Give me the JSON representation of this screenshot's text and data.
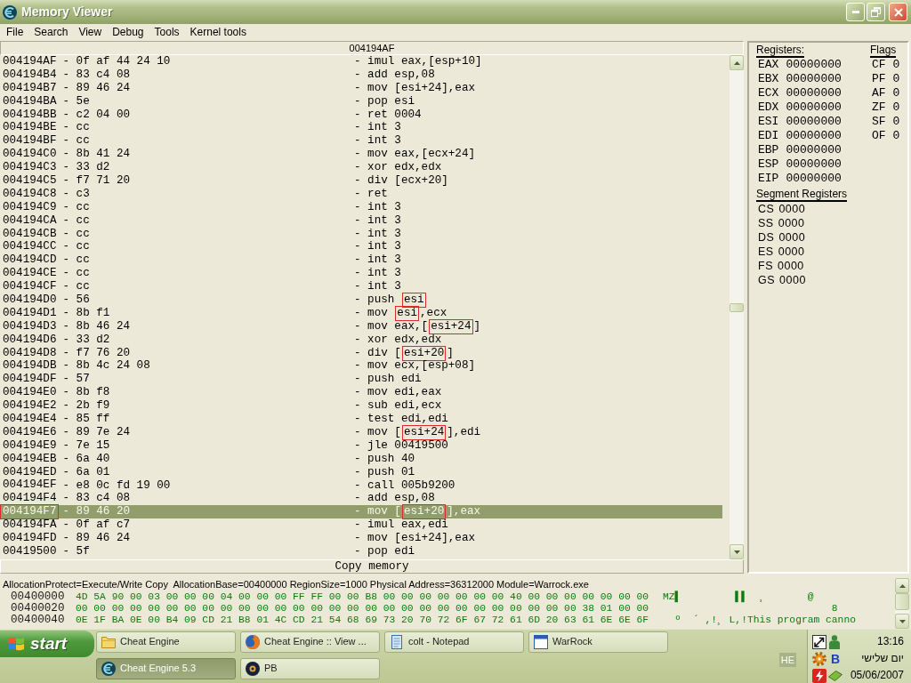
{
  "window": {
    "title": "Memory Viewer"
  },
  "menu": [
    "File",
    "Search",
    "View",
    "Debug",
    "Tools",
    "Kernel tools"
  ],
  "disassembly": {
    "header": "004194AF",
    "rows": [
      {
        "address": "004194AF",
        "bytes": "- 0f af 44 24 10",
        "instruction": [
          {
            "text": "- imul eax,[esp+10]",
            "boxed": false
          }
        ],
        "selected": false,
        "address_boxed": false
      },
      {
        "address": "004194B4",
        "bytes": "- 83 c4 08",
        "instruction": [
          {
            "text": "- add esp,08",
            "boxed": false
          }
        ],
        "selected": false,
        "address_boxed": false
      },
      {
        "address": "004194B7",
        "bytes": "- 89 46 24",
        "instruction": [
          {
            "text": "- mov [esi+24],eax",
            "boxed": false
          }
        ],
        "selected": false,
        "address_boxed": false
      },
      {
        "address": "004194BA",
        "bytes": "- 5e",
        "instruction": [
          {
            "text": "- pop esi",
            "boxed": false
          }
        ],
        "selected": false,
        "address_boxed": false
      },
      {
        "address": "004194BB",
        "bytes": "- c2 04 00",
        "instruction": [
          {
            "text": "- ret 0004",
            "boxed": false
          }
        ],
        "selected": false,
        "address_boxed": false
      },
      {
        "address": "004194BE",
        "bytes": "- cc",
        "instruction": [
          {
            "text": "- int 3",
            "boxed": false
          }
        ],
        "selected": false,
        "address_boxed": false
      },
      {
        "address": "004194BF",
        "bytes": "- cc",
        "instruction": [
          {
            "text": "- int 3",
            "boxed": false
          }
        ],
        "selected": false,
        "address_boxed": false
      },
      {
        "address": "004194C0",
        "bytes": "- 8b 41 24",
        "instruction": [
          {
            "text": "- mov eax,[ecx+24]",
            "boxed": false
          }
        ],
        "selected": false,
        "address_boxed": false
      },
      {
        "address": "004194C3",
        "bytes": "- 33 d2",
        "instruction": [
          {
            "text": "- xor edx,edx",
            "boxed": false
          }
        ],
        "selected": false,
        "address_boxed": false
      },
      {
        "address": "004194C5",
        "bytes": "- f7 71 20",
        "instruction": [
          {
            "text": "- div [ecx+20]",
            "boxed": false
          }
        ],
        "selected": false,
        "address_boxed": false
      },
      {
        "address": "004194C8",
        "bytes": "- c3",
        "instruction": [
          {
            "text": "- ret",
            "boxed": false
          }
        ],
        "selected": false,
        "address_boxed": false
      },
      {
        "address": "004194C9",
        "bytes": "- cc",
        "instruction": [
          {
            "text": "- int 3",
            "boxed": false
          }
        ],
        "selected": false,
        "address_boxed": false
      },
      {
        "address": "004194CA",
        "bytes": "- cc",
        "instruction": [
          {
            "text": "- int 3",
            "boxed": false
          }
        ],
        "selected": false,
        "address_boxed": false
      },
      {
        "address": "004194CB",
        "bytes": "- cc",
        "instruction": [
          {
            "text": "- int 3",
            "boxed": false
          }
        ],
        "selected": false,
        "address_boxed": false
      },
      {
        "address": "004194CC",
        "bytes": "- cc",
        "instruction": [
          {
            "text": "- int 3",
            "boxed": false
          }
        ],
        "selected": false,
        "address_boxed": false
      },
      {
        "address": "004194CD",
        "bytes": "- cc",
        "instruction": [
          {
            "text": "- int 3",
            "boxed": false
          }
        ],
        "selected": false,
        "address_boxed": false
      },
      {
        "address": "004194CE",
        "bytes": "- cc",
        "instruction": [
          {
            "text": "- int 3",
            "boxed": false
          }
        ],
        "selected": false,
        "address_boxed": false
      },
      {
        "address": "004194CF",
        "bytes": "- cc",
        "instruction": [
          {
            "text": "- int 3",
            "boxed": false
          }
        ],
        "selected": false,
        "address_boxed": false
      },
      {
        "address": "004194D0",
        "bytes": "- 56",
        "instruction": [
          {
            "text": "- push ",
            "boxed": false
          },
          {
            "text": "esi",
            "boxed": true
          }
        ],
        "selected": false,
        "address_boxed": false
      },
      {
        "address": "004194D1",
        "bytes": "- 8b f1",
        "instruction": [
          {
            "text": "- mov ",
            "boxed": false
          },
          {
            "text": "esi",
            "boxed": true
          },
          {
            "text": ",ecx",
            "boxed": false
          }
        ],
        "selected": false,
        "address_boxed": false
      },
      {
        "address": "004194D3",
        "bytes": "- 8b 46 24",
        "instruction": [
          {
            "text": "- mov eax,[",
            "boxed": false
          },
          {
            "text": "esi+24",
            "boxed": true
          },
          {
            "text": "]",
            "boxed": false
          }
        ],
        "selected": false,
        "address_boxed": false
      },
      {
        "address": "004194D6",
        "bytes": "- 33 d2",
        "instruction": [
          {
            "text": "- xor edx,edx",
            "boxed": false
          }
        ],
        "selected": false,
        "address_boxed": false
      },
      {
        "address": "004194D8",
        "bytes": "- f7 76 20",
        "instruction": [
          {
            "text": "- div [",
            "boxed": false
          },
          {
            "text": "esi+20",
            "boxed": true
          },
          {
            "text": "]",
            "boxed": false
          }
        ],
        "selected": false,
        "address_boxed": false
      },
      {
        "address": "004194DB",
        "bytes": "- 8b 4c 24 08",
        "instruction": [
          {
            "text": "- mov ecx,[esp+08]",
            "boxed": false
          }
        ],
        "selected": false,
        "address_boxed": false
      },
      {
        "address": "004194DF",
        "bytes": "- 57",
        "instruction": [
          {
            "text": "- push edi",
            "boxed": false
          }
        ],
        "selected": false,
        "address_boxed": false
      },
      {
        "address": "004194E0",
        "bytes": "- 8b f8",
        "instruction": [
          {
            "text": "- mov edi,eax",
            "boxed": false
          }
        ],
        "selected": false,
        "address_boxed": false
      },
      {
        "address": "004194E2",
        "bytes": "- 2b f9",
        "instruction": [
          {
            "text": "- sub edi,ecx",
            "boxed": false
          }
        ],
        "selected": false,
        "address_boxed": false
      },
      {
        "address": "004194E4",
        "bytes": "- 85 ff",
        "instruction": [
          {
            "text": "- test edi,edi",
            "boxed": false
          }
        ],
        "selected": false,
        "address_boxed": false
      },
      {
        "address": "004194E6",
        "bytes": "- 89 7e 24",
        "instruction": [
          {
            "text": "- mov [",
            "boxed": false
          },
          {
            "text": "esi+24",
            "boxed": true
          },
          {
            "text": "],edi",
            "boxed": false
          }
        ],
        "selected": false,
        "address_boxed": false
      },
      {
        "address": "004194E9",
        "bytes": "- 7e 15",
        "instruction": [
          {
            "text": "- jle 00419500",
            "boxed": false
          }
        ],
        "selected": false,
        "address_boxed": false
      },
      {
        "address": "004194EB",
        "bytes": "- 6a 40",
        "instruction": [
          {
            "text": "- push 40",
            "boxed": false
          }
        ],
        "selected": false,
        "address_boxed": false
      },
      {
        "address": "004194ED",
        "bytes": "- 6a 01",
        "instruction": [
          {
            "text": "- push 01",
            "boxed": false
          }
        ],
        "selected": false,
        "address_boxed": false
      },
      {
        "address": "004194EF",
        "bytes": "- e8 0c fd 19 00",
        "instruction": [
          {
            "text": "- call 005b9200",
            "boxed": false
          }
        ],
        "selected": false,
        "address_boxed": false
      },
      {
        "address": "004194F4",
        "bytes": "- 83 c4 08",
        "instruction": [
          {
            "text": "- add esp,08",
            "boxed": false
          }
        ],
        "selected": false,
        "address_boxed": false
      },
      {
        "address": "004194F7",
        "bytes": "- 89 46 20",
        "instruction": [
          {
            "text": "- mov [",
            "boxed": false
          },
          {
            "text": "esi+20",
            "boxed": true
          },
          {
            "text": "],eax",
            "boxed": false
          }
        ],
        "selected": true,
        "address_boxed": true
      },
      {
        "address": "004194FA",
        "bytes": "- 0f af c7",
        "instruction": [
          {
            "text": "- imul eax,edi",
            "boxed": false
          }
        ],
        "selected": false,
        "address_boxed": false
      },
      {
        "address": "004194FD",
        "bytes": "- 89 46 24",
        "instruction": [
          {
            "text": "- mov [esi+24],eax",
            "boxed": false
          }
        ],
        "selected": false,
        "address_boxed": false
      },
      {
        "address": "00419500",
        "bytes": "- 5f",
        "instruction": [
          {
            "text": "- pop edi",
            "boxed": false
          }
        ],
        "selected": false,
        "address_boxed": false
      }
    ],
    "footer": "Copy memory"
  },
  "registers": {
    "title": "Registers:",
    "items": [
      {
        "name": "EAX",
        "value": "00000000"
      },
      {
        "name": "EBX",
        "value": "00000000"
      },
      {
        "name": "ECX",
        "value": "00000000"
      },
      {
        "name": "EDX",
        "value": "00000000"
      },
      {
        "name": "ESI",
        "value": "00000000"
      },
      {
        "name": "EDI",
        "value": "00000000"
      },
      {
        "name": "EBP",
        "value": "00000000"
      },
      {
        "name": "ESP",
        "value": "00000000"
      },
      {
        "name": "EIP",
        "value": "00000000"
      }
    ],
    "flags_title": "Flags",
    "flags": [
      {
        "name": "CF",
        "value": "0"
      },
      {
        "name": "PF",
        "value": "0"
      },
      {
        "name": "AF",
        "value": "0"
      },
      {
        "name": "ZF",
        "value": "0"
      },
      {
        "name": "SF",
        "value": "0"
      },
      {
        "name": "OF",
        "value": "0"
      }
    ],
    "segment_title": "Segment Registers",
    "segments": [
      {
        "name": "CS",
        "value": "0000"
      },
      {
        "name": "SS",
        "value": "0000"
      },
      {
        "name": "DS",
        "value": "0000"
      },
      {
        "name": "ES",
        "value": "0000"
      },
      {
        "name": "FS",
        "value": "0000"
      },
      {
        "name": "GS",
        "value": "0000"
      }
    ]
  },
  "hex_view": {
    "info": "AllocationProtect=Execute/Write Copy  AllocationBase=00400000 RegionSize=1000 Physical Address=36312000 Module=Warrock.exe",
    "rows": [
      {
        "address": "00400000",
        "bytes": "4D 5A 90 00 03 00 00 00 04 00 00 00 FF FF 00 00 B8 00 00 00 00 00 00 00 40 00 00 00 00 00 00 00",
        "ascii": "MZ▌         ▌▌  ¸       @"
      },
      {
        "address": "00400020",
        "bytes": "00 00 00 00 00 00 00 00 00 00 00 00 00 00 00 00 00 00 00 00 00 00 00 00 00 00 00 00 38 01 00 00",
        "ascii": "                            8"
      },
      {
        "address": "00400040",
        "bytes": "0E 1F BA 0E 00 B4 09 CD 21 B8 01 4C CD 21 54 68 69 73 20 70 72 6F 67 72 61 6D 20 63 61 6E 6E 6F",
        "ascii": "  º  ´ ,!¸ L,!This program canno"
      }
    ]
  },
  "taskbar": {
    "start": "start",
    "button_rows": [
      [
        {
          "label": "Cheat Engine",
          "kind": "folder",
          "selected": false
        },
        {
          "label": "Cheat Engine :: View ...",
          "kind": "browser",
          "selected": false
        },
        {
          "label": "colt - Notepad",
          "kind": "notepad",
          "selected": false
        },
        {
          "label": "WarRock",
          "kind": "window",
          "selected": false
        }
      ],
      [
        {
          "label": "Cheat Engine 5.3",
          "kind": "engine",
          "selected": true
        },
        {
          "label": "PB",
          "kind": "disc",
          "selected": false
        }
      ]
    ],
    "language": "HE",
    "tray_letter": "B",
    "clock": {
      "time": "13:16",
      "day": "יום שלישי",
      "date": "05/06/2007"
    }
  }
}
